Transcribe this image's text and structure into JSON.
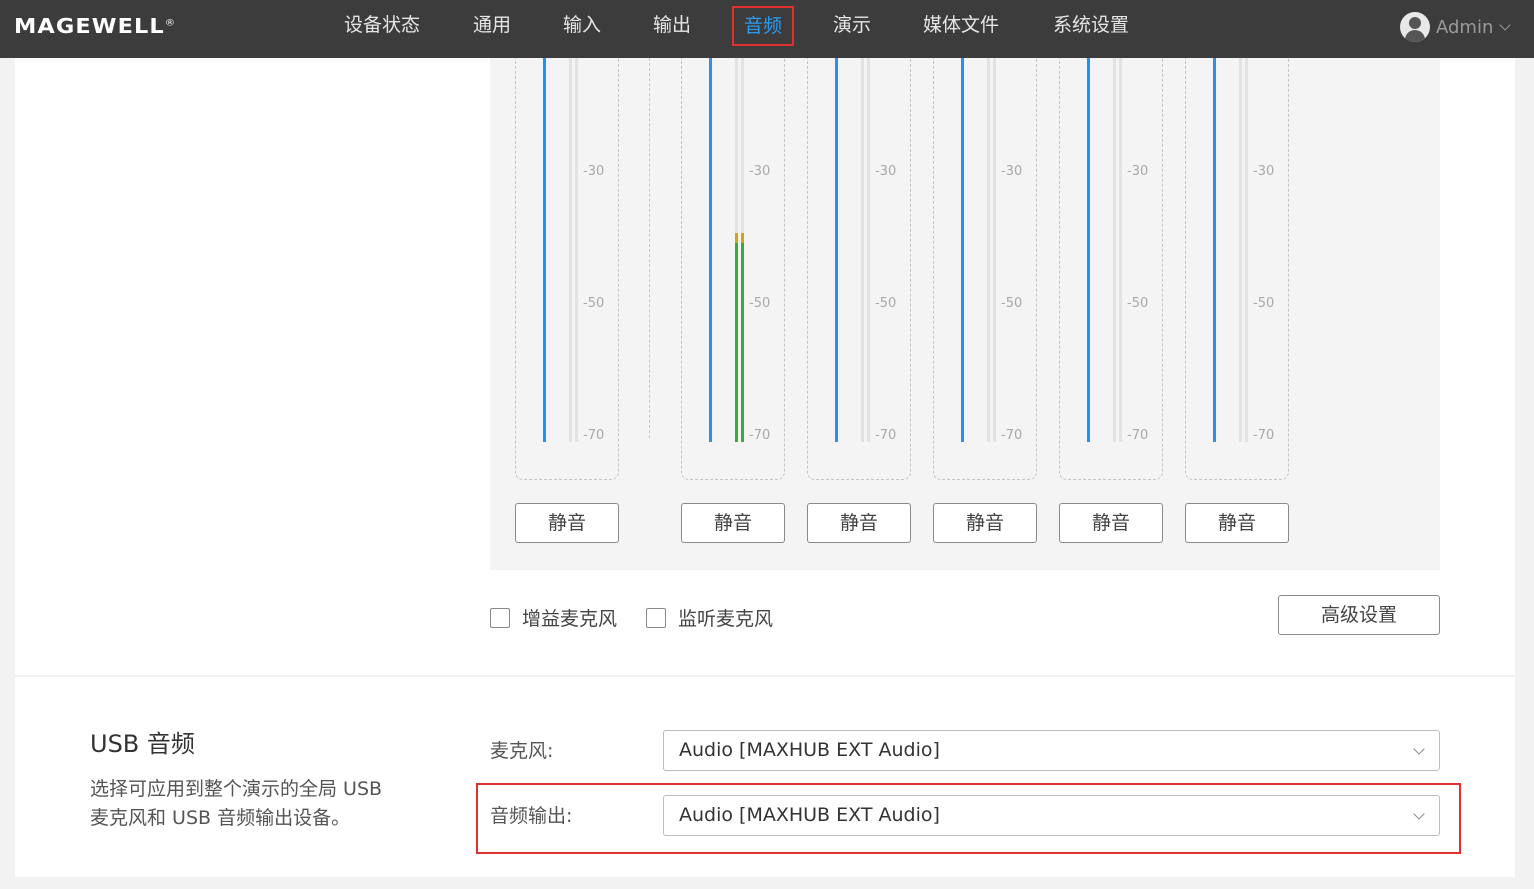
{
  "header": {
    "logo": "MAGEWELL",
    "logo_mark": "®",
    "nav": [
      "设备状态",
      "通用",
      "输入",
      "输出",
      "音频",
      "演示",
      "媒体文件",
      "系统设置"
    ],
    "active_nav": "音频",
    "user": "Admin",
    "user_icon": "user-avatar-icon"
  },
  "mixer": {
    "tick_labels": [
      "-30",
      "-50",
      "-70"
    ],
    "channels": [
      {
        "mute_label": "静音",
        "level_db": null
      },
      {
        "mute_label": "静音",
        "level_db": -40
      },
      {
        "mute_label": "静音",
        "level_db": null
      },
      {
        "mute_label": "静音",
        "level_db": null
      },
      {
        "mute_label": "静音",
        "level_db": null
      },
      {
        "mute_label": "静音",
        "level_db": null
      }
    ],
    "colors": {
      "fader": "#2a8ff0",
      "level_green": "#3aaa3a",
      "level_yellow": "#d6a21a"
    }
  },
  "options": {
    "gain_mic": "增益麦克风",
    "monitor_mic": "监听麦克风",
    "advanced": "高级设置"
  },
  "usb_audio": {
    "title": "USB 音频",
    "description_line1": "选择可应用到整个演示的全局 USB",
    "description_line2": "麦克风和 USB 音频输出设备。",
    "mic_label": "麦克风:",
    "mic_value": "Audio [MAXHUB EXT Audio]",
    "output_label": "音频输出:",
    "output_value": "Audio [MAXHUB EXT Audio]"
  },
  "accent": "#2a9cf2",
  "highlight_color": "#e03030"
}
